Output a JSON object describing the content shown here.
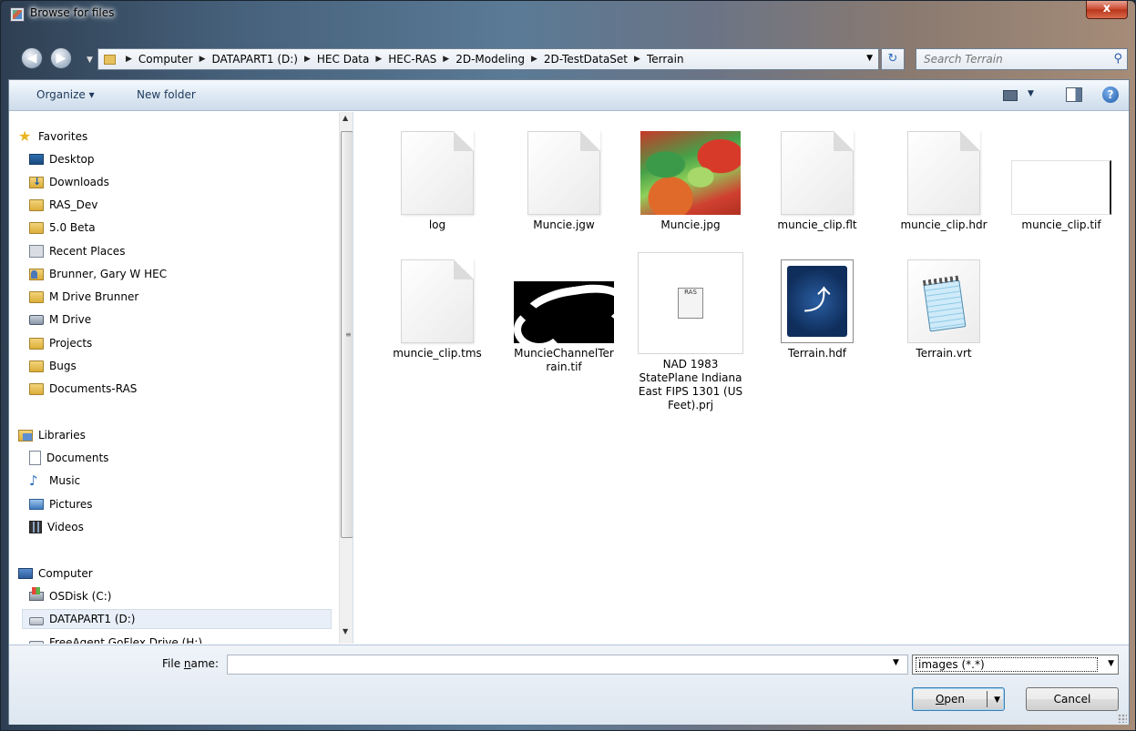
{
  "window": {
    "title": "Browse for files",
    "close_glyph": "x"
  },
  "nav": {
    "back_glyph": "◀",
    "forward_glyph": "▶",
    "breadcrumbs": [
      "Computer",
      "DATAPART1 (D:)",
      "HEC Data",
      "HEC-RAS",
      "2D-Modeling",
      "2D-TestDataSet",
      "Terrain"
    ],
    "refresh_glyph": "↻",
    "search_placeholder": "Search Terrain",
    "search_glyph": "⚲"
  },
  "toolbar": {
    "organize_label": "Organize ▾",
    "new_folder_label": "New folder",
    "help_glyph": "?"
  },
  "sidebar": {
    "favorites_label": "Favorites",
    "favorites": [
      {
        "label": "Desktop",
        "icon": "desktop-icon"
      },
      {
        "label": "Downloads",
        "icon": "downloads-icon"
      },
      {
        "label": "RAS_Dev",
        "icon": "folder-icon"
      },
      {
        "label": "5.0 Beta",
        "icon": "folder-icon"
      },
      {
        "label": "Recent Places",
        "icon": "recent-places-icon"
      },
      {
        "label": "Brunner, Gary W HEC",
        "icon": "user-folder-icon"
      },
      {
        "label": "M Drive Brunner",
        "icon": "folder-icon"
      },
      {
        "label": "M Drive",
        "icon": "network-drive-icon"
      },
      {
        "label": "Projects",
        "icon": "folder-icon"
      },
      {
        "label": "Bugs",
        "icon": "folder-icon"
      },
      {
        "label": "Documents-RAS",
        "icon": "folder-icon"
      }
    ],
    "libraries_label": "Libraries",
    "libraries": [
      {
        "label": "Documents",
        "icon": "document-icon"
      },
      {
        "label": "Music",
        "icon": "music-icon"
      },
      {
        "label": "Pictures",
        "icon": "pictures-icon"
      },
      {
        "label": "Videos",
        "icon": "videos-icon"
      }
    ],
    "computer_label": "Computer",
    "drives": [
      {
        "label": "OSDisk (C:)",
        "icon": "os-disk-icon"
      },
      {
        "label": "DATAPART1 (D:)",
        "icon": "drive-icon",
        "selected": true
      },
      {
        "label": "FreeAgent GoFlex Drive (H:)",
        "icon": "drive-icon"
      }
    ]
  },
  "files": [
    {
      "name": "log",
      "kind": "blank-file-icon"
    },
    {
      "name": "Muncie.jgw",
      "kind": "blank-file-icon"
    },
    {
      "name": "Muncie.jpg",
      "kind": "terrain-image-thumbnail"
    },
    {
      "name": "muncie_clip.flt",
      "kind": "blank-file-icon"
    },
    {
      "name": "muncie_clip.hdr",
      "kind": "blank-file-icon"
    },
    {
      "name": "muncie_clip.tif",
      "kind": "white-image-thumbnail"
    },
    {
      "name": "muncie_clip.tms",
      "kind": "blank-file-icon"
    },
    {
      "name": "MuncieChannelTerrain.tif",
      "kind": "channel-mask-thumbnail"
    },
    {
      "name": "NAD 1983 StatePlane Indiana East FIPS 1301 (US Feet).prj",
      "kind": "ras-projection-icon"
    },
    {
      "name": "Terrain.hdf",
      "kind": "hdf-icon"
    },
    {
      "name": "Terrain.vrt",
      "kind": "notepad-icon"
    }
  ],
  "prj_badge": "RAS",
  "bottom": {
    "file_name_label_pre": "File ",
    "file_name_label_u": "n",
    "file_name_label_post": "ame:",
    "file_name_value": "",
    "filter_value": "images (*.*)",
    "open_label_u": "O",
    "open_label_rest": "pen",
    "cancel_label": "Cancel"
  }
}
